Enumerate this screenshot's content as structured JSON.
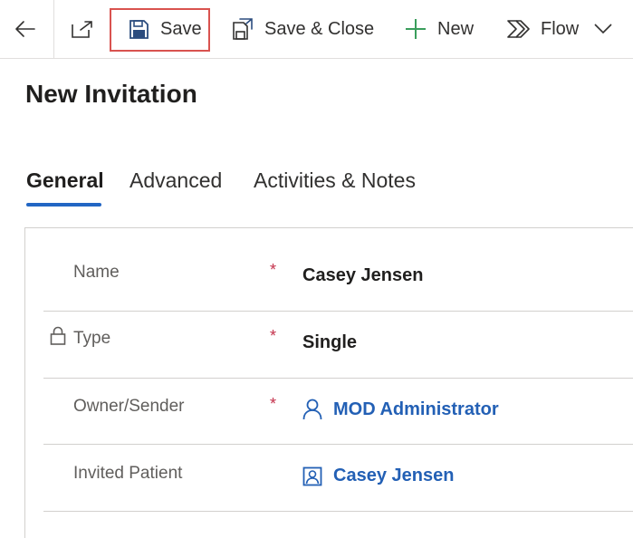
{
  "command_bar": {
    "save_label": "Save",
    "save_close_label": "Save & Close",
    "new_label": "New",
    "flow_label": "Flow"
  },
  "header": {
    "title": "New Invitation"
  },
  "tabs": [
    {
      "label": "General",
      "active": true
    },
    {
      "label": "Advanced",
      "active": false
    },
    {
      "label": "Activities & Notes",
      "active": false
    }
  ],
  "form": {
    "name": {
      "label": "Name",
      "required": "*",
      "value": "Casey Jensen"
    },
    "type": {
      "label": "Type",
      "required": "*",
      "value": "Single"
    },
    "owner": {
      "label": "Owner/Sender",
      "required": "*",
      "value": "MOD Administrator"
    },
    "invited_patient": {
      "label": "Invited Patient",
      "value": "Casey Jensen"
    }
  },
  "colors": {
    "accent": "#2266c4",
    "lookup_link": "#2360b5",
    "required": "#c4314b",
    "highlight_box": "#d9534f",
    "new_icon": "#3a9e5c"
  }
}
